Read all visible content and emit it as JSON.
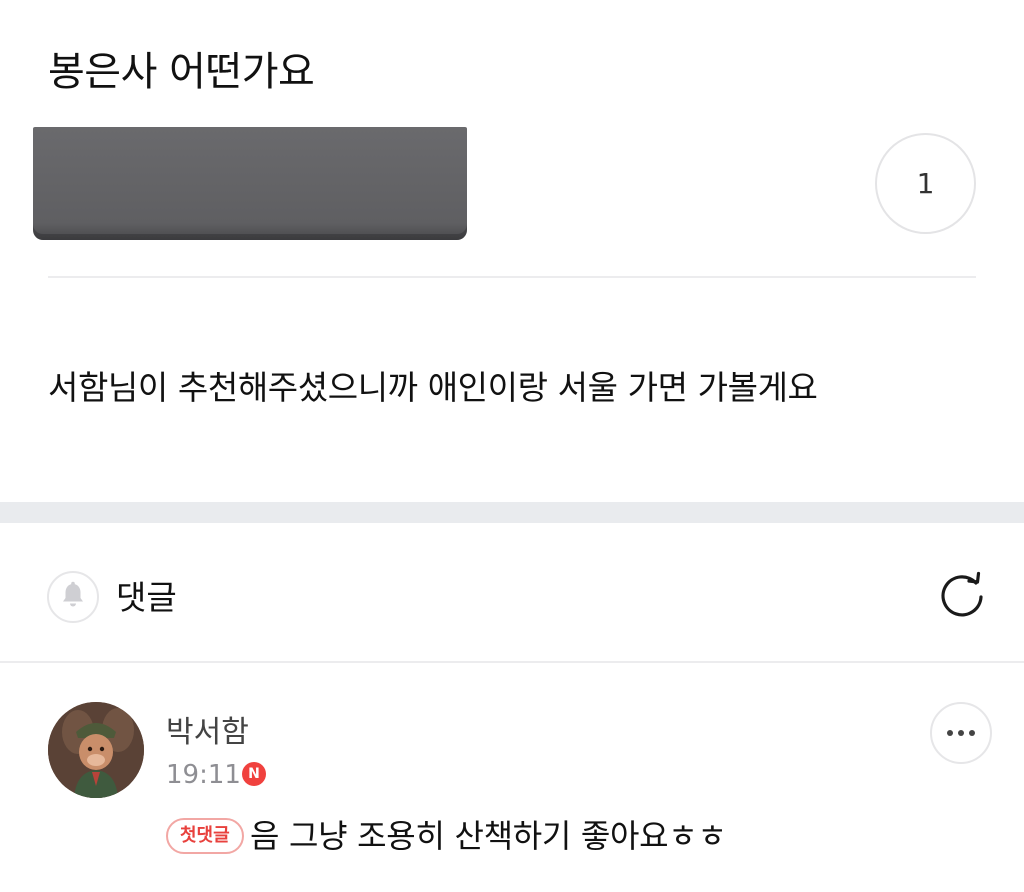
{
  "post": {
    "title": "봉은사 어떤가요",
    "like_count": "1",
    "body": "서함님이 추천해주셨으니까 애인이랑 서울 가면 가볼게요"
  },
  "comments_header": {
    "label": "댓글",
    "bell_icon": "bell-icon",
    "refresh_icon": "refresh-icon"
  },
  "comment": {
    "author": "박서함",
    "time": "19:11",
    "new_badge": "N",
    "first_comment_badge": "첫댓글",
    "text": "음 그냥 조용히 산책하기 좋아요ㅎㅎ",
    "more_icon": "more-icon"
  },
  "colors": {
    "accent_red": "#f0413e",
    "divider": "#ececee",
    "section_gap": "#e9ebee",
    "redaction": "#636366"
  }
}
